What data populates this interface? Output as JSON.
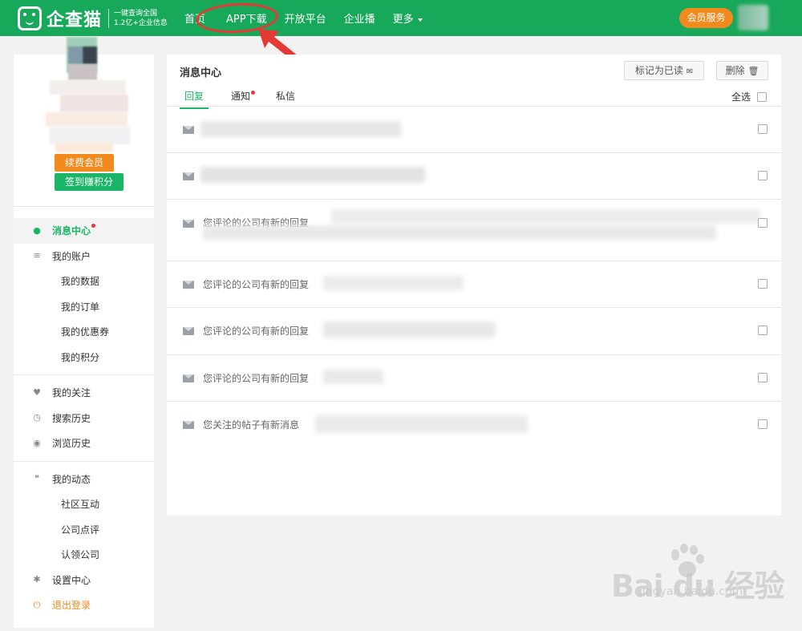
{
  "header": {
    "logo_text": "企查猫",
    "slogan_line1": "一键查询全国",
    "slogan_line2": "1.2亿+企业信息",
    "nav": [
      "首页",
      "APP下载",
      "开放平台",
      "企业播",
      "更多"
    ],
    "vip_button": "会员服务"
  },
  "sidebar": {
    "renew_button": "续费会员",
    "signin_button": "签到赚积分",
    "items": [
      {
        "label": "消息中心",
        "icon": "chat-bubble-icon",
        "active": true,
        "dot": true
      },
      {
        "label": "我的账户",
        "icon": "database-icon"
      },
      {
        "label": "我的数据",
        "sub": true
      },
      {
        "label": "我的订单",
        "sub": true
      },
      {
        "label": "我的优惠券",
        "sub": true
      },
      {
        "label": "我的积分",
        "sub": true
      },
      {
        "label": "我的关注",
        "icon": "heart-icon"
      },
      {
        "label": "搜索历史",
        "icon": "clock-icon"
      },
      {
        "label": "浏览历史",
        "icon": "browse-icon"
      },
      {
        "label": "我的动态",
        "icon": "comments-icon"
      },
      {
        "label": "社区互动",
        "sub": true
      },
      {
        "label": "公司点评",
        "sub": true
      },
      {
        "label": "认领公司",
        "sub": true
      },
      {
        "label": "设置中心",
        "icon": "gear-icon"
      },
      {
        "label": "退出登录",
        "icon": "power-icon"
      }
    ]
  },
  "main": {
    "title": "消息中心",
    "mark_read_button": "标记为已读",
    "delete_button": "删除",
    "tabs": [
      "回复",
      "通知",
      "私信"
    ],
    "select_all": "全选",
    "messages": [
      {
        "text": ""
      },
      {
        "text": ""
      },
      {
        "text": "您评论的公司有新的回复"
      },
      {
        "text": "您评论的公司有新的回复"
      },
      {
        "text": "您评论的公司有新的回复"
      },
      {
        "text": "您评论的公司有新的回复"
      },
      {
        "text": "您关注的帖子有新消息"
      }
    ]
  },
  "watermark": {
    "brand": "Bai du 经验",
    "url": "jingyan.baidu.com"
  },
  "colors": {
    "brand_green": "#17a85a",
    "accent_orange": "#f38a1e",
    "annotation_red": "#e53935"
  }
}
